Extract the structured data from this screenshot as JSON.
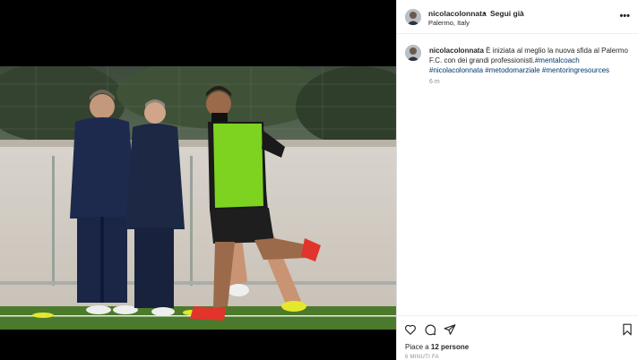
{
  "post": {
    "username": "nicolacolonnata",
    "separator": "•",
    "follow_label": "Segui già",
    "location": "Palermo, Italy",
    "more_icon": "more-horizontal-icon"
  },
  "caption": {
    "username": "nicolacolonnata",
    "text": "È iniziata al meglio la nuova sfida al Palermo F.C. con dei grandi professionisti.",
    "tags": [
      "#mentalcoach",
      "#nicolacolonnata",
      "#metodomarziale",
      "#mentoringresources"
    ],
    "time": "6 m"
  },
  "actions": {
    "icons": [
      "heart-icon",
      "comment-icon",
      "share-icon",
      "bookmark-icon"
    ],
    "likes_prefix": "Piace a",
    "likes_count": "12 persone",
    "posted_ago": "6 MINUTI FA"
  },
  "colors": {
    "hashtag": "#00376b",
    "bib": "#7ed321",
    "pitch": "#4c7a2c"
  }
}
